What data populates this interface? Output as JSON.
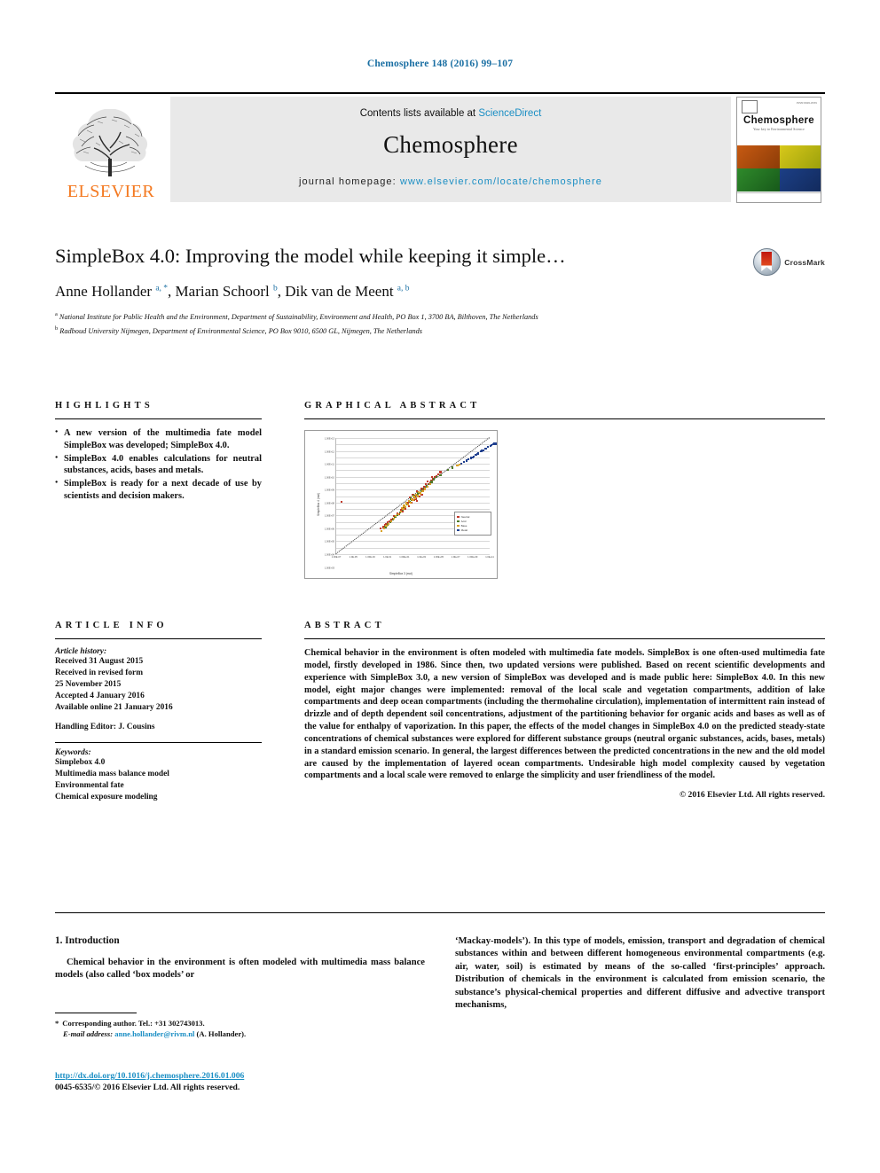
{
  "running_head": "Chemosphere 148 (2016) 99–107",
  "masthead": {
    "publisher": "ELSEVIER",
    "contents_prefix": "Contents lists available at ",
    "contents_link": "ScienceDirect",
    "journal_name": "Chemosphere",
    "homepage_prefix": "journal homepage: ",
    "homepage_url": "www.elsevier.com/locate/chemosphere",
    "cover": {
      "title": "Chemosphere",
      "subtitle": "Your key to Environmental Science",
      "issn_tag": "ISSN 0045-6535"
    }
  },
  "article": {
    "title": "SimpleBox 4.0: Improving the model while keeping it simple…",
    "authors_html": "Anne Hollander <sup>a, *</sup>, Marian Schoorl <sup>b</sup>, Dik van de Meent <sup>a, b</sup>",
    "affiliation_a": "National Institute for Public Health and the Environment, Department of Sustainability, Environment and Health, PO Box 1, 3700 BA, Bilthoven, The Netherlands",
    "affiliation_b": "Radboud University Nijmegen, Department of Environmental Science, PO Box 9010, 6500 GL, Nijmegen, The Netherlands",
    "crossmark_label": "CrossMark"
  },
  "highlights": {
    "heading": "HIGHLIGHTS",
    "items": [
      "A new version of the multimedia fate model SimpleBox was developed; SimpleBox 4.0.",
      "SimpleBox 4.0 enables calculations for neutral substances, acids, bases and metals.",
      "SimpleBox is ready for a next decade of use by scientists and decision makers."
    ]
  },
  "graphical_abstract": {
    "heading": "GRAPHICAL ABSTRACT"
  },
  "chart_data": {
    "type": "scatter",
    "title": "",
    "xlabel": "SimpleBox 3 (mol)",
    "ylabel": "SimpleBox 4 (mol)",
    "xlim": [
      -7,
      12
    ],
    "ylim": [
      -5,
      13
    ],
    "grid": true,
    "legend_position": "right",
    "xticks": [
      "1.00E-07",
      "1.0E-05",
      "1.00E-03",
      "1.0E-01",
      "1.00E+01",
      "1.0E+03",
      "1.00E+05",
      "1.0E+07",
      "1.00E+09",
      "1.0E+11"
    ],
    "yticks": [
      "1.00E+13",
      "1.00E+12",
      "1.00E+11",
      "1.00E+10",
      "1.00E+09",
      "1.00E+08",
      "1.00E+07",
      "1.00E+06",
      "1.00E+05",
      "1.00E+04",
      "1.00E+03",
      "1.00E+02",
      "1.00E+01",
      "1.00E+00",
      "1.00E-01",
      "1.00E-02",
      "1.00E-03",
      "1.00E-04",
      "1.00E-05"
    ],
    "reference_line": "y = x (1:1 dotted diagonal)",
    "series": [
      {
        "name": "Neutral",
        "color": "#c0392b",
        "points": [
          [
            2.3,
            3.0
          ],
          [
            2.6,
            3.4
          ],
          [
            2.9,
            3.6
          ],
          [
            3.1,
            4.1
          ],
          [
            3.4,
            4.3
          ],
          [
            3.6,
            4.7
          ],
          [
            3.8,
            5.0
          ],
          [
            4.0,
            5.3
          ],
          [
            4.2,
            5.6
          ],
          [
            4.4,
            5.9
          ],
          [
            4.6,
            6.1
          ],
          [
            4.8,
            6.4
          ],
          [
            5.0,
            6.6
          ],
          [
            5.2,
            6.9
          ],
          [
            5.4,
            7.1
          ],
          [
            3.0,
            3.3
          ],
          [
            3.3,
            3.9
          ],
          [
            3.6,
            4.2
          ],
          [
            2.0,
            2.4
          ],
          [
            1.6,
            2.0
          ],
          [
            1.2,
            1.6
          ],
          [
            0.8,
            1.2
          ],
          [
            0.4,
            0.8
          ],
          [
            0.0,
            0.5
          ],
          [
            -0.4,
            0.1
          ],
          [
            -0.8,
            -0.3
          ],
          [
            -1.2,
            -0.8
          ],
          [
            -6.3,
            3.1
          ],
          [
            5.6,
            7.4
          ],
          [
            5.9,
            7.7
          ],
          [
            4.9,
            7.0
          ],
          [
            4.3,
            6.3
          ],
          [
            3.9,
            5.4
          ],
          [
            3.2,
            4.6
          ],
          [
            2.8,
            4.0
          ],
          [
            2.4,
            3.5
          ],
          [
            1.9,
            2.9
          ],
          [
            1.4,
            2.3
          ],
          [
            1.0,
            1.8
          ],
          [
            0.6,
            1.3
          ],
          [
            0.2,
            0.9
          ],
          [
            -0.2,
            0.4
          ],
          [
            -0.6,
            0.0
          ],
          [
            -1.0,
            -0.5
          ],
          [
            -1.5,
            -1.0
          ],
          [
            2.1,
            3.8
          ],
          [
            2.5,
            4.2
          ],
          [
            3.0,
            4.8
          ],
          [
            3.5,
            5.2
          ],
          [
            4.1,
            5.8
          ]
        ]
      },
      {
        "name": "Acid",
        "color": "#4f7a28",
        "points": [
          [
            1.8,
            2.7
          ],
          [
            2.1,
            3.1
          ],
          [
            2.4,
            3.4
          ],
          [
            2.7,
            3.8
          ],
          [
            3.0,
            4.1
          ],
          [
            3.3,
            4.5
          ],
          [
            3.6,
            4.8
          ],
          [
            3.9,
            5.2
          ],
          [
            4.2,
            5.5
          ],
          [
            4.5,
            5.9
          ],
          [
            1.5,
            2.3
          ],
          [
            1.2,
            1.9
          ],
          [
            0.9,
            1.5
          ],
          [
            0.6,
            1.1
          ],
          [
            0.3,
            0.8
          ],
          [
            0.0,
            0.4
          ],
          [
            -0.3,
            0.0
          ],
          [
            -0.6,
            -0.4
          ],
          [
            -0.9,
            -0.8
          ],
          [
            4.8,
            6.2
          ],
          [
            5.1,
            6.6
          ],
          [
            5.4,
            6.9
          ],
          [
            2.2,
            3.6
          ],
          [
            2.6,
            4.0
          ],
          [
            3.1,
            4.4
          ],
          [
            3.5,
            4.9
          ],
          [
            5.9,
            7.2
          ],
          [
            6.8,
            8.0
          ],
          [
            7.4,
            8.4
          ]
        ]
      },
      {
        "name": "Base",
        "color": "#d9a227",
        "points": [
          [
            1.0,
            1.6
          ],
          [
            1.3,
            2.0
          ],
          [
            1.6,
            2.3
          ],
          [
            1.9,
            2.7
          ],
          [
            2.2,
            3.0
          ],
          [
            2.5,
            3.4
          ],
          [
            2.8,
            3.7
          ],
          [
            3.1,
            4.0
          ],
          [
            3.4,
            4.4
          ],
          [
            3.7,
            4.7
          ],
          [
            0.7,
            1.2
          ],
          [
            0.4,
            0.9
          ],
          [
            0.1,
            0.5
          ],
          [
            -0.2,
            0.1
          ],
          [
            -0.5,
            -0.3
          ],
          [
            -0.8,
            -0.6
          ],
          [
            -1.1,
            -1.0
          ],
          [
            -1.4,
            -1.4
          ],
          [
            4.0,
            5.1
          ],
          [
            4.3,
            5.4
          ],
          [
            4.6,
            5.8
          ],
          [
            2.0,
            3.2
          ],
          [
            2.3,
            3.5
          ],
          [
            2.6,
            3.9
          ],
          [
            2.9,
            4.2
          ],
          [
            3.2,
            4.6
          ],
          [
            1.7,
            2.9
          ],
          [
            1.4,
            2.5
          ],
          [
            1.1,
            2.1
          ],
          [
            8.0,
            8.7
          ],
          [
            8.3,
            8.9
          ]
        ]
      },
      {
        "name": "Metal",
        "color": "#20408f",
        "points": [
          [
            8.8,
            9.3
          ],
          [
            9.1,
            9.5
          ],
          [
            9.4,
            9.7
          ],
          [
            9.7,
            9.9
          ],
          [
            10.0,
            10.1
          ],
          [
            10.3,
            10.4
          ],
          [
            10.6,
            10.6
          ],
          [
            10.9,
            10.9
          ],
          [
            11.2,
            11.1
          ],
          [
            11.5,
            11.3
          ],
          [
            11.8,
            11.6
          ],
          [
            12.1,
            11.8
          ],
          [
            12.4,
            12.0
          ],
          [
            8.5,
            9.0
          ],
          [
            9.9,
            10.0
          ],
          [
            10.5,
            10.5
          ],
          [
            11.0,
            11.0
          ],
          [
            11.6,
            11.4
          ],
          [
            12.2,
            11.9
          ],
          [
            12.6,
            12.1
          ],
          [
            12.9,
            12.1
          ],
          [
            13.2,
            12.1
          ]
        ]
      }
    ]
  },
  "article_info": {
    "heading": "ARTICLE INFO",
    "history_label": "Article history:",
    "history_lines": [
      "Received 31 August 2015",
      "Received in revised form",
      "25 November 2015",
      "Accepted 4 January 2016",
      "Available online 21 January 2016"
    ],
    "handling_editor": "Handling Editor: J. Cousins",
    "keywords_label": "Keywords:",
    "keywords": [
      "Simplebox 4.0",
      "Multimedia mass balance model",
      "Environmental fate",
      "Chemical exposure modeling"
    ]
  },
  "abstract": {
    "heading": "ABSTRACT",
    "text": "Chemical behavior in the environment is often modeled with multimedia fate models. SimpleBox is one often-used multimedia fate model, firstly developed in 1986. Since then, two updated versions were published. Based on recent scientific developments and experience with SimpleBox 3.0, a new version of SimpleBox was developed and is made public here: SimpleBox 4.0. In this new model, eight major changes were implemented: removal of the local scale and vegetation compartments, addition of lake compartments and deep ocean compartments (including the thermohaline circulation), implementation of intermittent rain instead of drizzle and of depth dependent soil concentrations, adjustment of the partitioning behavior for organic acids and bases as well as of the value for enthalpy of vaporization. In this paper, the effects of the model changes in SimpleBox 4.0 on the predicted steady-state concentrations of chemical substances were explored for different substance groups (neutral organic substances, acids, bases, metals) in a standard emission scenario. In general, the largest differences between the predicted concentrations in the new and the old model are caused by the implementation of layered ocean compartments. Undesirable high model complexity caused by vegetation compartments and a local scale were removed to enlarge the simplicity and user friendliness of the model.",
    "copyright": "© 2016 Elsevier Ltd. All rights reserved."
  },
  "body": {
    "section_heading": "1. Introduction",
    "left_paragraph": "Chemical behavior in the environment is often modeled with multimedia mass balance models (also called ‘box models’ or",
    "right_paragraph": "‘Mackay-models’). In this type of models, emission, transport and degradation of chemical substances within and between different homogeneous environmental compartments (e.g. air, water, soil) is estimated by means of the so-called ‘first-principles’ approach. Distribution of chemicals in the environment is calculated from emission scenario, the substance’s physical-chemical properties and different diffusive and advective transport mechanisms,"
  },
  "footnotes": {
    "corresponding": "Corresponding author. Tel.: +31 302743013.",
    "email_label": "E-mail address:",
    "email": "anne.hollander@rivm.nl",
    "email_suffix": "(A. Hollander)."
  },
  "footer": {
    "doi": "http://dx.doi.org/10.1016/j.chemosphere.2016.01.006",
    "issn_line": "0045-6535/© 2016 Elsevier Ltd. All rights reserved."
  }
}
